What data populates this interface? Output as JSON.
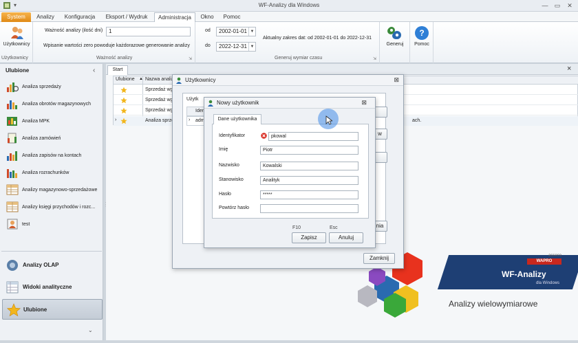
{
  "window": {
    "title": "WF-Analizy dla Windows"
  },
  "menu": {
    "tabs": [
      "System",
      "Analizy",
      "Konfiguracja",
      "Eksport / Wydruk",
      "Administracja",
      "Okno",
      "Pomoc"
    ]
  },
  "ribbon": {
    "users_label": "Użytkownicy",
    "users_group": "Użytkownicy",
    "ile_label": "Ważność analizy (ilość dni)",
    "ile_value": "1",
    "note": "Wpisanie wartości zero powoduje każdorazowe generowanie analizy",
    "params_group": "Ważność analizy",
    "od_label": "od",
    "od_value": "2002-01-01",
    "do_label": "do",
    "do_value": "2022-12-31",
    "range_text": "Aktualny zakres dat: od 2002-01-01 do 2022-12-31",
    "generate_label": "Generuj",
    "gen_group": "Generuj wymiar czasu",
    "help_label": "Pomoc"
  },
  "sidebar": {
    "title": "Ulubione",
    "collapse": "‹",
    "favorites": [
      "Analiza sprzedaży",
      "Analiza obrotów magazynowych",
      "Analiza MPK",
      "Analiza zamówień",
      "Analiza zapisów na kontach",
      "Analiza rozrachunków",
      "Analizy magazynowo-sprzedażowe",
      "Analizy księgi przychodów i rozc...",
      "test"
    ],
    "nav": [
      "Analizy OLAP",
      "Widoki analityczne",
      "Ulubione"
    ],
    "more": "⌄"
  },
  "main": {
    "tab": "Start",
    "close": "×",
    "grid_headers": [
      "Ulubione",
      "Nazwa analizy"
    ],
    "rows": [
      "Sprzedaż wg k",
      "Sprzedaż wg k",
      "Sprzedaż wg k",
      "Analiza sprze"
    ],
    "row_tail": "ach.",
    "brand": "WF-Analizy",
    "brand_sub": "dla Windows",
    "tagline": "Analizy wielowymiarowe",
    "logo_top": "asseco",
    "logo_bottom": "WAPRO"
  },
  "users_dialog": {
    "title": "Użytkownicy",
    "tab": "Użytk",
    "col": "Iden",
    "row": "adm",
    "close": "⊠",
    "partial_btn": "nia",
    "partial_btn2": "w",
    "close_button": "Zamknij"
  },
  "new_user_dialog": {
    "title": "Nowy użytkownik",
    "close": "⊠",
    "tab": "Dane użytkownika",
    "fields": [
      {
        "label": "Identyfikator",
        "value": "pkowal"
      },
      {
        "label": "Imię",
        "value": "Piotr"
      },
      {
        "label": "Nazwisko",
        "value": "Kowalski"
      },
      {
        "label": "Stanowisko",
        "value": "Analityk"
      },
      {
        "label": "Hasło",
        "value": "*****"
      },
      {
        "label": "Powtórz hasło",
        "value": ""
      }
    ],
    "save_key": "F10",
    "cancel_key": "Esc",
    "save": "Zapisz",
    "cancel": "Anuluj"
  }
}
